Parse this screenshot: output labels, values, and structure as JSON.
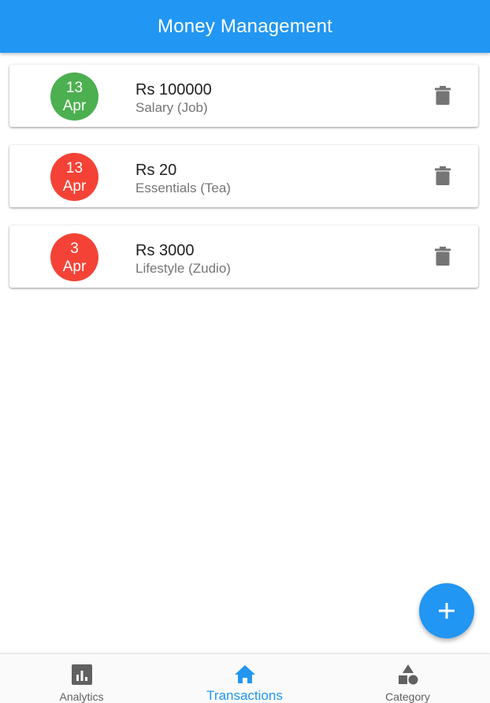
{
  "appbar": {
    "title": "Money Management"
  },
  "theme": {
    "primary": "#2196f3",
    "income": "#4caf50",
    "expense": "#f44336",
    "icon_gray": "#757575"
  },
  "transactions": [
    {
      "day": "13",
      "month": "Apr",
      "amount": "Rs 100000",
      "category": "Salary (Job)",
      "type": "income"
    },
    {
      "day": "13",
      "month": "Apr",
      "amount": "Rs 20",
      "category": "Essentials (Tea)",
      "type": "expense"
    },
    {
      "day": "3",
      "month": "Apr",
      "amount": "Rs 3000",
      "category": "Lifestyle (Zudio)",
      "type": "expense"
    }
  ],
  "icons": {
    "delete": "trash-icon",
    "fab": "plus-icon",
    "analytics": "bar-chart-icon",
    "transactions": "home-icon",
    "category": "shapes-icon"
  },
  "bottom_nav": {
    "items": [
      {
        "label": "Analytics",
        "active": false
      },
      {
        "label": "Transactions",
        "active": true
      },
      {
        "label": "Category",
        "active": false
      }
    ]
  }
}
